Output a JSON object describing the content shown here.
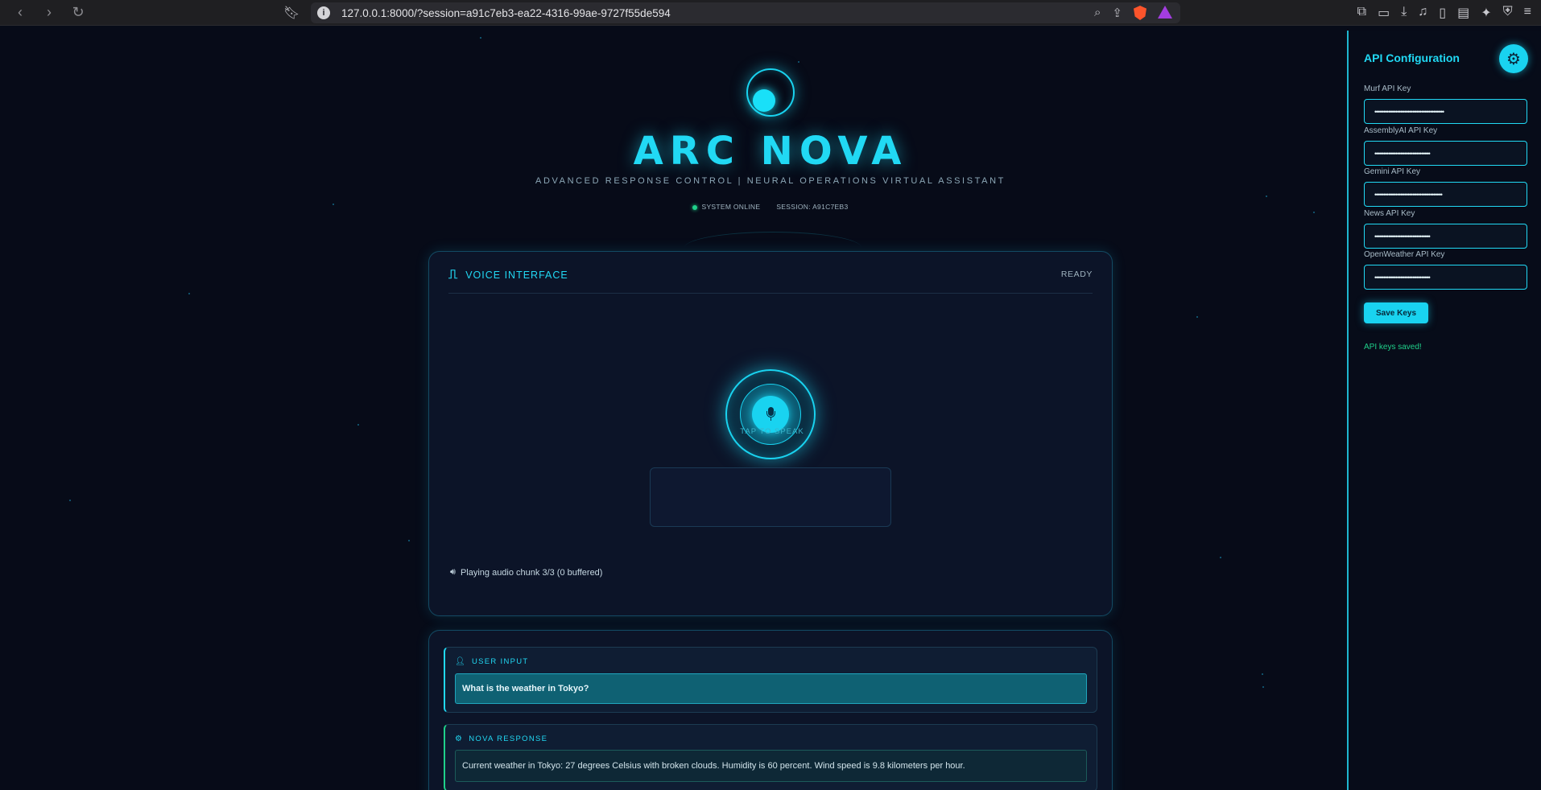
{
  "browser": {
    "url": "127.0.0.1:8000/?session=a91c7eb3-ea22-4316-99ae-9727f55de594"
  },
  "header": {
    "title": "ARC NOVA",
    "subtitle": "ADVANCED RESPONSE CONTROL | NEURAL OPERATIONS VIRTUAL ASSISTANT",
    "status": "SYSTEM ONLINE",
    "session": "SESSION: A91C7EB3"
  },
  "voice": {
    "label": "VOICE INTERFACE",
    "state": "READY",
    "tap_label": "TAP TO SPEAK",
    "audio_status": "Playing audio chunk 3/3 (0 buffered)"
  },
  "conversation": {
    "user_label": "USER INPUT",
    "user_text": "What is the weather in Tokyo?",
    "nova_label": "NOVA RESPONSE",
    "nova_text": "Current weather in Tokyo: 27 degrees Celsius with broken clouds. Humidity is 60 percent. Wind speed is 9.8 kilometers per hour."
  },
  "sidebar": {
    "title": "API Configuration",
    "fields": [
      {
        "label": "Murf API Key",
        "value": "••••••••••••••••••••••••••••••••••••••••"
      },
      {
        "label": "AssemblyAI API Key",
        "value": "••••••••••••••••••••••••••••••••"
      },
      {
        "label": "Gemini API Key",
        "value": "•••••••••••••••••••••••••••••••••••••••"
      },
      {
        "label": "News API Key",
        "value": "••••••••••••••••••••••••••••••••"
      },
      {
        "label": "OpenWeather API Key",
        "value": "••••••••••••••••••••••••••••••••"
      }
    ],
    "save_label": "Save Keys",
    "saved_msg": "API keys saved!"
  },
  "colors": {
    "accent": "#21d9f4",
    "background": "#070b18",
    "success": "#1fd18a"
  }
}
